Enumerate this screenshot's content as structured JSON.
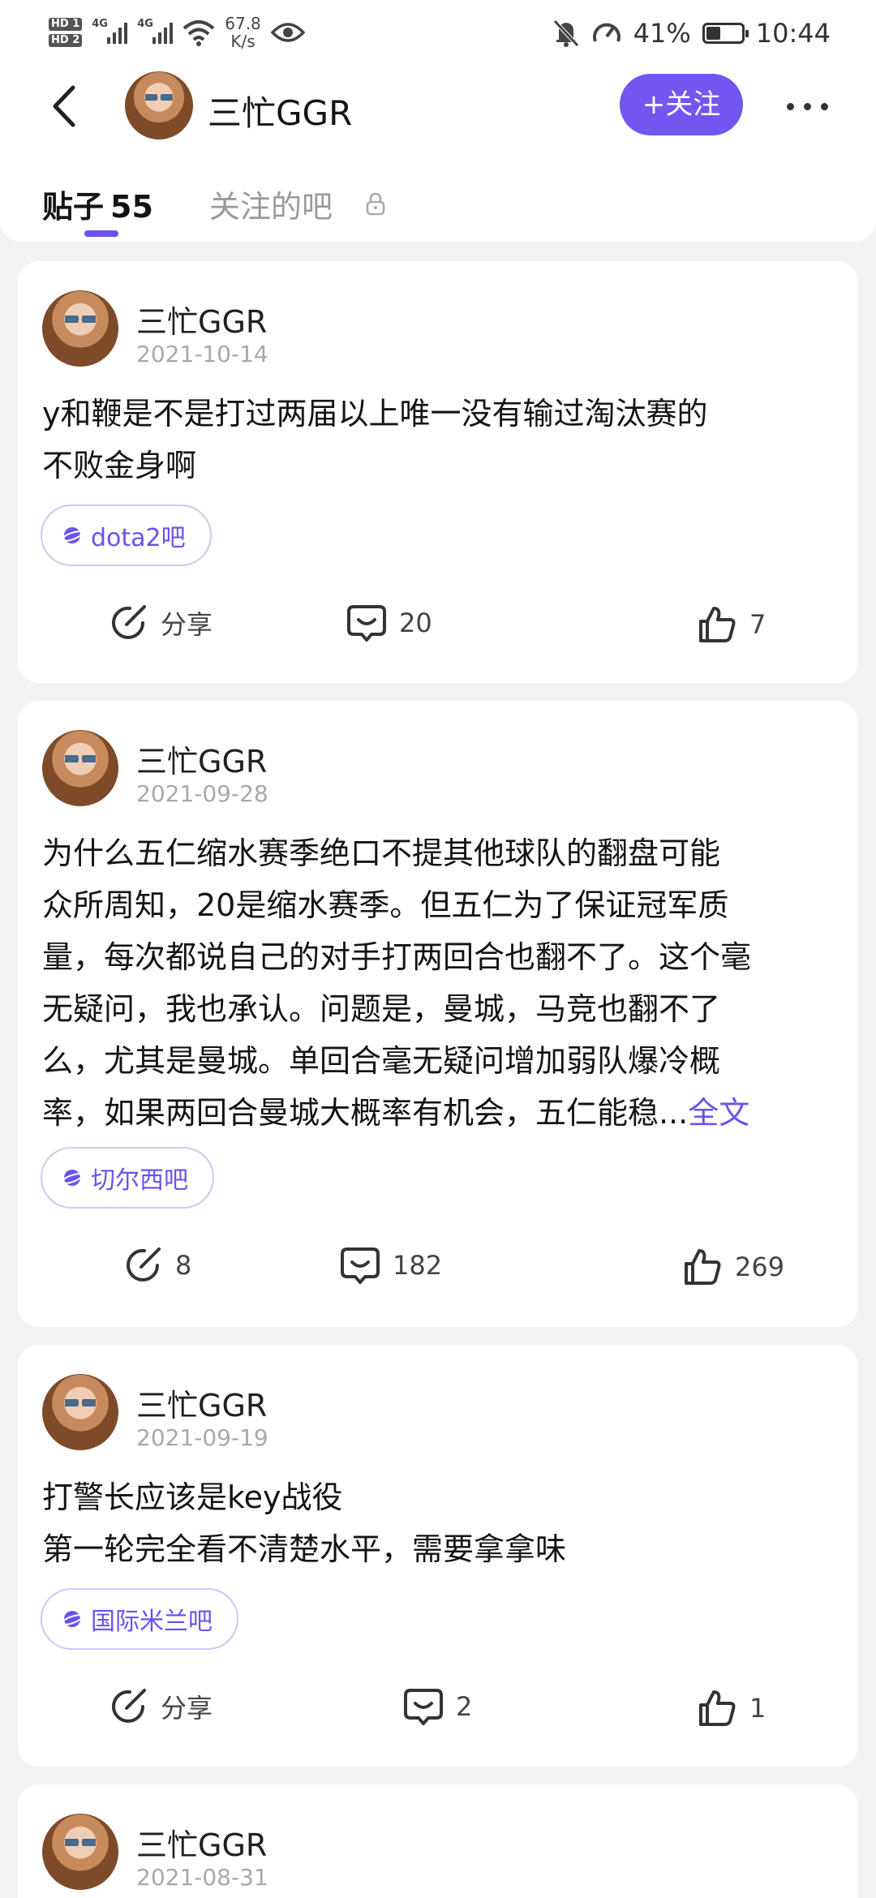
{
  "status_bar": {
    "hd1": "HD 1",
    "hd2": "HD 2",
    "network1": "4G",
    "network2": "4G",
    "speed_value": "67.8",
    "speed_unit": "K/s",
    "battery_percent": "41%",
    "battery_level": 0.41,
    "time": "10:44"
  },
  "header": {
    "title": "三忙GGR",
    "follow_label": "+关注"
  },
  "tabs": {
    "posts_label": "贴子",
    "posts_count": "55",
    "forums_label": "关注的吧"
  },
  "colors": {
    "accent": "#7355f0",
    "tag_border": "#cfc7f5",
    "muted_text": "#a9a9a9"
  },
  "posts": [
    {
      "author": "三忙GGR",
      "date": "2021-10-14",
      "lines": [
        "y和鞭是不是打过两届以上唯一没有输过淘汰赛的",
        "不败金身啊"
      ],
      "readmore": "",
      "tag": "dota2吧",
      "share": "分享",
      "comments": "20",
      "likes": "7"
    },
    {
      "author": "三忙GGR",
      "date": "2021-09-28",
      "lines": [
        "为什么五仁缩水赛季绝口不提其他球队的翻盘可能",
        "众所周知，20是缩水赛季。但五仁为了保证冠军质",
        "量，每次都说自己的对手打两回合也翻不了。这个毫",
        "无疑问，我也承认。问题是，曼城，马竞也翻不了",
        "么，尤其是曼城。单回合毫无疑问增加弱队爆冷概",
        "率，如果两回合曼城大概率有机会，五仁能稳..."
      ],
      "readmore": "全文",
      "tag": "切尔西吧",
      "share": "8",
      "comments": "182",
      "likes": "269"
    },
    {
      "author": "三忙GGR",
      "date": "2021-09-19",
      "lines": [
        "打警长应该是key战役",
        "第一轮完全看不清楚水平，需要拿拿味"
      ],
      "readmore": "",
      "tag": "国际米兰吧",
      "share": "分享",
      "comments": "2",
      "likes": "1"
    },
    {
      "author": "三忙GGR",
      "date": "2021-08-31"
    }
  ]
}
